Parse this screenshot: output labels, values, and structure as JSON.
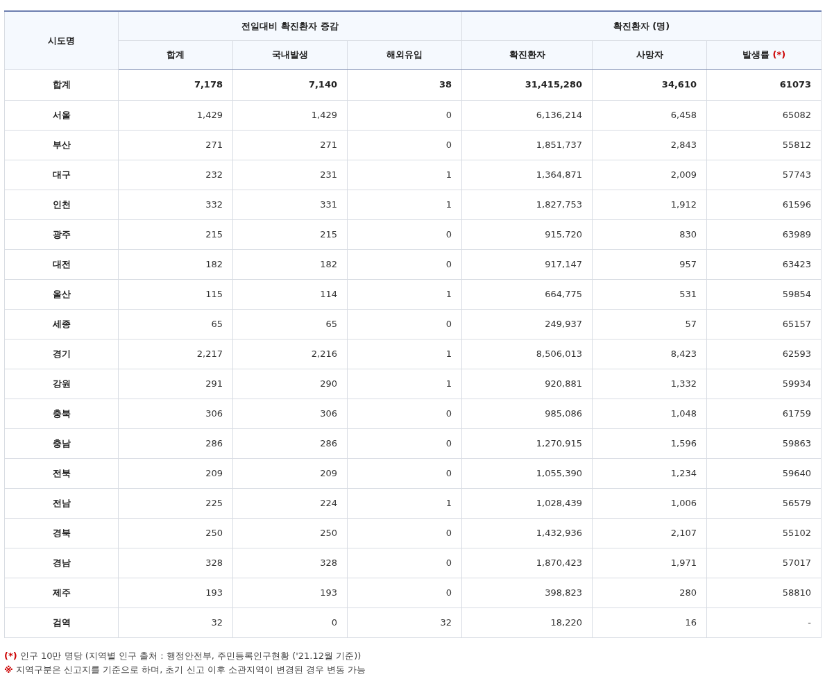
{
  "table": {
    "region_header": "시도명",
    "groups": [
      {
        "label": "전일대비 확진환자 증감"
      },
      {
        "label": "확진환자 (명)"
      }
    ],
    "columns": [
      {
        "label": "합계"
      },
      {
        "label": "국내발생"
      },
      {
        "label": "해외유입"
      },
      {
        "label": "확진환자"
      },
      {
        "label": "사망자"
      },
      {
        "label": "발생률",
        "note_mark": "(*)"
      }
    ],
    "rows": [
      {
        "kind": "total",
        "region": "합계",
        "cells": [
          "7,178",
          "7,140",
          "38",
          "31,415,280",
          "34,610",
          "61073"
        ]
      },
      {
        "kind": "region",
        "region": "서울",
        "cells": [
          "1,429",
          "1,429",
          "0",
          "6,136,214",
          "6,458",
          "65082"
        ]
      },
      {
        "kind": "region",
        "region": "부산",
        "cells": [
          "271",
          "271",
          "0",
          "1,851,737",
          "2,843",
          "55812"
        ]
      },
      {
        "kind": "region",
        "region": "대구",
        "cells": [
          "232",
          "231",
          "1",
          "1,364,871",
          "2,009",
          "57743"
        ]
      },
      {
        "kind": "region",
        "region": "인천",
        "cells": [
          "332",
          "331",
          "1",
          "1,827,753",
          "1,912",
          "61596"
        ]
      },
      {
        "kind": "region",
        "region": "광주",
        "cells": [
          "215",
          "215",
          "0",
          "915,720",
          "830",
          "63989"
        ]
      },
      {
        "kind": "region",
        "region": "대전",
        "cells": [
          "182",
          "182",
          "0",
          "917,147",
          "957",
          "63423"
        ]
      },
      {
        "kind": "region",
        "region": "울산",
        "cells": [
          "115",
          "114",
          "1",
          "664,775",
          "531",
          "59854"
        ]
      },
      {
        "kind": "region",
        "region": "세종",
        "cells": [
          "65",
          "65",
          "0",
          "249,937",
          "57",
          "65157"
        ]
      },
      {
        "kind": "region",
        "region": "경기",
        "cells": [
          "2,217",
          "2,216",
          "1",
          "8,506,013",
          "8,423",
          "62593"
        ]
      },
      {
        "kind": "region",
        "region": "강원",
        "cells": [
          "291",
          "290",
          "1",
          "920,881",
          "1,332",
          "59934"
        ]
      },
      {
        "kind": "region",
        "region": "충북",
        "cells": [
          "306",
          "306",
          "0",
          "985,086",
          "1,048",
          "61759"
        ]
      },
      {
        "kind": "region",
        "region": "충남",
        "cells": [
          "286",
          "286",
          "0",
          "1,270,915",
          "1,596",
          "59863"
        ]
      },
      {
        "kind": "region",
        "region": "전북",
        "cells": [
          "209",
          "209",
          "0",
          "1,055,390",
          "1,234",
          "59640"
        ]
      },
      {
        "kind": "region",
        "region": "전남",
        "cells": [
          "225",
          "224",
          "1",
          "1,028,439",
          "1,006",
          "56579"
        ]
      },
      {
        "kind": "region",
        "region": "경북",
        "cells": [
          "250",
          "250",
          "0",
          "1,432,936",
          "2,107",
          "55102"
        ]
      },
      {
        "kind": "region",
        "region": "경남",
        "cells": [
          "328",
          "328",
          "0",
          "1,870,423",
          "1,971",
          "57017"
        ]
      },
      {
        "kind": "region",
        "region": "제주",
        "cells": [
          "193",
          "193",
          "0",
          "398,823",
          "280",
          "58810"
        ]
      },
      {
        "kind": "region",
        "region": "검역",
        "cells": [
          "32",
          "0",
          "32",
          "18,220",
          "16",
          "-"
        ]
      }
    ]
  },
  "notes": [
    {
      "mark": "(*)",
      "text": "인구 10만 명당 (지역별 인구 출처 : 행정안전부, 주민등록인구현황 ('21.12월 기준))"
    },
    {
      "mark": "※",
      "text": "지역구분은 신고지를 기준으로 하며, 초기 신고 이후 소관지역이 변경된 경우 변동 가능"
    }
  ]
}
